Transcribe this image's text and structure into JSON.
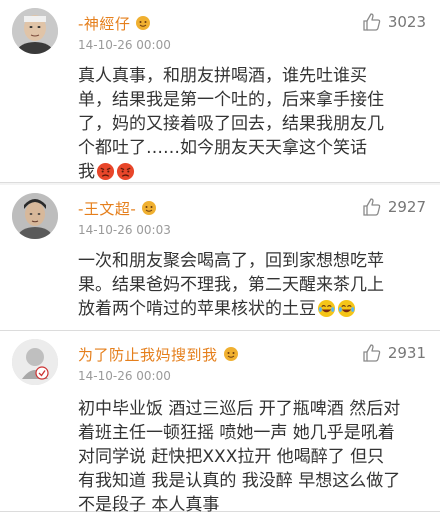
{
  "comments": [
    {
      "username": "-神經仔",
      "timestamp": "14-10-26 00:00",
      "likes": "3023",
      "lines": [
        "真人真事，和朋友拼喝酒，谁先吐谁买",
        "单，结果我是第一个吐的，后来拿手接住",
        "了，妈的又接着吸了回去，结果我朋友几",
        "个都吐了……如今朋友天天拿这个笑话",
        "我"
      ],
      "emojis": [
        "angry-face-icon",
        "angry-face-icon"
      ]
    },
    {
      "username": "-王文超-",
      "timestamp": "14-10-26 00:03",
      "likes": "2927",
      "lines": [
        "一次和朋友聚会喝高了，回到家想想吃苹",
        "果。结果爸妈不理我，第二天醒来茶几上",
        "放着两个啃过的苹果核状的土豆"
      ],
      "emojis": [
        "laughing-crying-face-icon",
        "laughing-crying-face-icon"
      ]
    },
    {
      "username": "为了防止我妈搜到我",
      "timestamp": "14-10-26 00:00",
      "likes": "2931",
      "lines": [
        "初中毕业饭 酒过三巡后 开了瓶啤酒 然后对",
        "着班主任一顿狂摇 喷她一声 她几乎是吼着",
        "对同学说 赶快把XXX拉开 他喝醉了 但只",
        "有我知道 我是认真的 我没醉 早想这么做了",
        "不是段子 本人真事"
      ],
      "emojis": []
    }
  ]
}
